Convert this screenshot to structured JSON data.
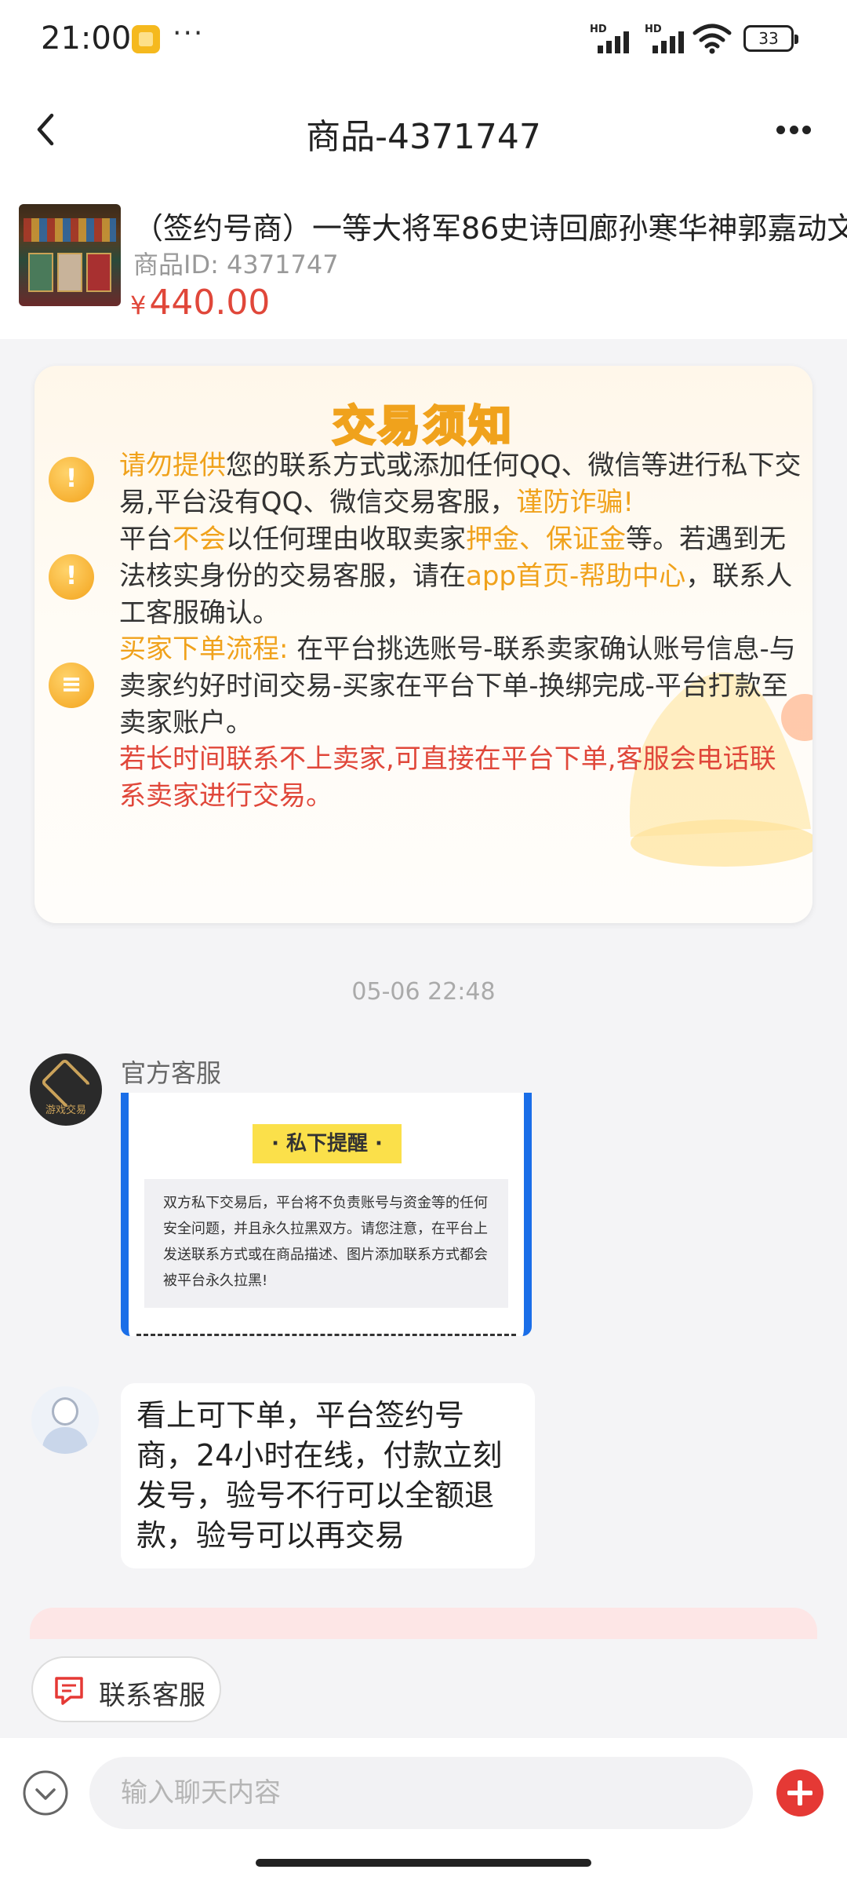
{
  "status_bar": {
    "time": "21:00",
    "dots": "···",
    "hd1": "HD",
    "hd2": "HD",
    "battery": "33"
  },
  "nav": {
    "title": "商品-4371747"
  },
  "product": {
    "title": "（签约号商）一等大将军86史诗回廊孙寒华神郭嘉动文",
    "id_label": "商品ID: 4371747",
    "currency": "¥",
    "price": "440.00"
  },
  "notice": {
    "title": "交易须知",
    "p1_a": "请勿提供",
    "p1_b": "您的联系方式或添加任何QQ、微信等进行私下交易,平台没有QQ、微信交易客服，",
    "p1_c": "谨防诈骗!",
    "p2_a": "平台",
    "p2_b": "不会",
    "p2_c": "以任何理由收取卖家",
    "p2_d": "押金、保证金",
    "p2_e": "等。若遇到无法核实身份的交易客服，请在",
    "p2_f": "app首页-帮助中心",
    "p2_g": "，联系人工客服确认。",
    "p3_a": "买家下单流程:",
    "p3_b": " 在平台挑选账号-联系卖家确认账号信息-与卖家约好时间交易-买家在平台下单-换绑完成-平台打款至卖家账户。",
    "p4": "若长时间联系不上卖家,可直接在平台下单,客服会电话联系卖家进行交易。"
  },
  "chat": {
    "timestamp": "05-06 22:48",
    "official_name": "官方客服",
    "official_avatar_tag": "游戏交易",
    "image_card": {
      "tag": "· 私下提醒 ·",
      "body": "双方私下交易后，平台将不负责账号与资金等的任何安全问题，并且永久拉黑双方。请您注意，在平台上发送联系方式或在商品描述、图片添加联系方式都会被平台永久拉黑!"
    },
    "user_message": "看上可下单，平台签约号商，24小时在线，付款立刻发号，验号不行可以全额退款，验号可以再交易"
  },
  "contact_button": {
    "label": "联系客服"
  },
  "input": {
    "placeholder": "输入聊天内容"
  },
  "colors": {
    "accent_red": "#e0473a",
    "accent_orange": "#f0a21c",
    "bubble_blue": "#1a6ee8"
  }
}
